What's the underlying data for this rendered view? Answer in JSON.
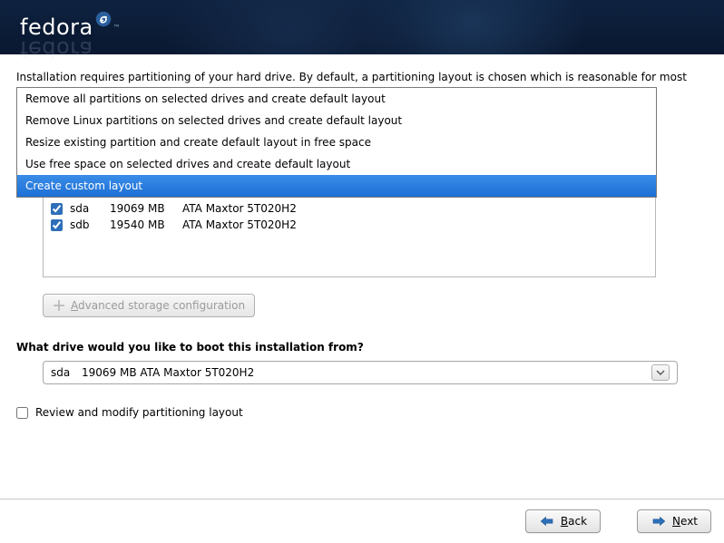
{
  "brand": "fedora",
  "intro": "Installation requires partitioning of your hard drive.  By default, a partitioning layout is chosen which is reasonable for most",
  "dropdown": {
    "items": [
      "Remove all partitions on selected drives and create default layout",
      "Remove Linux partitions on selected drives and create default layout",
      "Resize existing partition and create default layout in free space",
      "Use free space on selected drives and create default layout",
      "Create custom layout"
    ],
    "selected_index": 4
  },
  "drives": [
    {
      "checked": true,
      "dev": "sda",
      "size": "19069 MB",
      "model": "ATA Maxtor 5T020H2"
    },
    {
      "checked": true,
      "dev": "sdb",
      "size": "19540 MB",
      "model": "ATA Maxtor 5T020H2"
    }
  ],
  "advanced_button": {
    "prefix": "A",
    "rest": "dvanced storage configuration"
  },
  "boot_label": "What drive would you like to boot this installation from?",
  "boot_select": {
    "dev": "sda",
    "rest": "19069 MB ATA Maxtor 5T020H2"
  },
  "review": {
    "checked": false,
    "label": "Review and modify partitioning layout"
  },
  "footer": {
    "back": {
      "prefix": "B",
      "rest": "ack"
    },
    "next": {
      "prefix": "N",
      "rest": "ext"
    }
  }
}
